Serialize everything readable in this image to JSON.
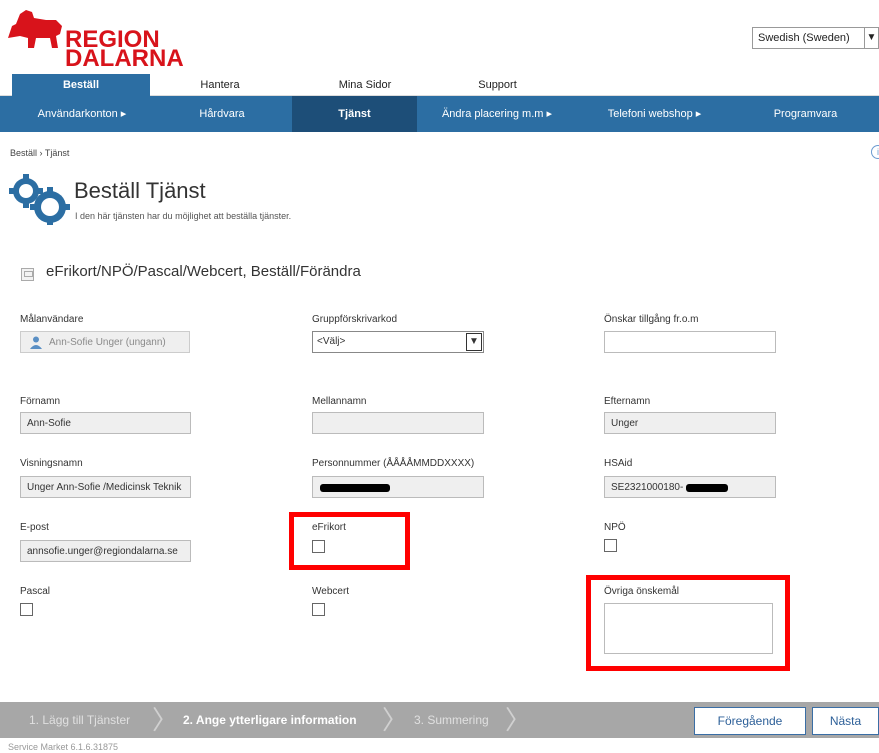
{
  "logo": {
    "line1": "REGION",
    "line2": "DALARNA"
  },
  "language": {
    "selected": "Swedish (Sweden)"
  },
  "nav_main": [
    "Beställ",
    "Hantera",
    "Mina Sidor",
    "Support"
  ],
  "nav_sub": [
    "Användarkonton ▸",
    "Hårdvara",
    "Tjänst",
    "Ändra placering m.m ▸",
    "Telefoni webshop ▸",
    "Programvara"
  ],
  "breadcrumb": "Beställ › Tjänst",
  "page": {
    "title": "Beställ Tjänst",
    "subtitle": "I den här tjänsten har du möjlighet att beställa tjänster."
  },
  "section": {
    "title": "eFrikort/NPÖ/Pascal/Webcert, Beställ/Förändra"
  },
  "form": {
    "malanvandare_label": "Målanvändare",
    "malanvandare_value": "Ann-Sofie Unger (ungann)",
    "grupp_label": "Gruppförskrivarkod",
    "grupp_value": "<Välj>",
    "onskar_label": "Önskar tillgång fr.o.m",
    "onskar_value": "",
    "fornamn_label": "Förnamn",
    "fornamn_value": "Ann-Sofie",
    "mellannamn_label": "Mellannamn",
    "mellannamn_value": "",
    "efternamn_label": "Efternamn",
    "efternamn_value": "Unger",
    "visningsnamn_label": "Visningsnamn",
    "visningsnamn_value": "Unger Ann-Sofie /Medicinsk Teknik",
    "personnummer_label": "Personnummer (ÅÅÅÅMMDDXXXX)",
    "hsaid_label": "HSAid",
    "hsaid_value": "SE2321000180-",
    "epost_label": "E-post",
    "epost_value": "annsofie.unger@regiondalarna.se",
    "efrikort_label": "eFrikort",
    "npo_label": "NPÖ",
    "pascal_label": "Pascal",
    "webcert_label": "Webcert",
    "ovriga_label": "Övriga önskemål"
  },
  "wizard": {
    "step1": "1. Lägg till Tjänster",
    "step2": "2. Ange ytterligare information",
    "step3": "3. Summering",
    "prev": "Föregående",
    "next": "Nästa"
  },
  "version": "Service Market 6.1.6.31875",
  "colors": {
    "brand_red": "#d8131b",
    "nav_blue": "#2c6ea3",
    "highlight_red": "#ff0000"
  }
}
